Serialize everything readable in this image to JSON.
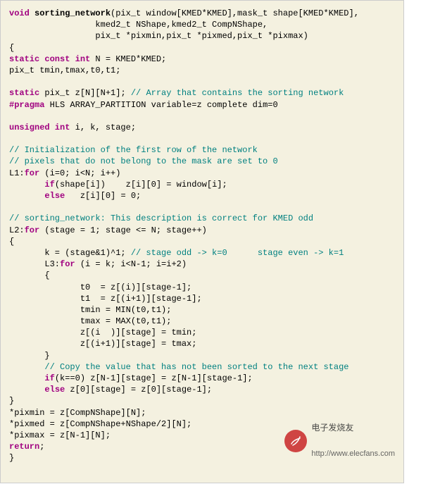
{
  "code": {
    "l1a": "void",
    "l1b": " sorting_network",
    "l1c": "(pix_t window[KMED*KMED],mask_t shape[KMED*KMED],",
    "l2": "                 kmed2_t NShape,kmed2_t CompNShape,",
    "l3": "                 pix_t *pixmin,pix_t *pixmed,pix_t *pixmax)",
    "l4": "{",
    "l5a": "static const int",
    "l5b": " N = KMED*KMED;",
    "l6": "pix_t tmin,tmax,t0,t1;",
    "l7": "",
    "l8a": "static",
    "l8b": " pix_t z[N][N+1]; ",
    "l8c": "// Array that contains the sorting network",
    "l9a": "#pragma",
    "l9b": " HLS ARRAY_PARTITION variable=z complete dim=0",
    "l10": "",
    "l11a": "unsigned int",
    "l11b": " i, k, stage;",
    "l12": "",
    "l13": "// Initialization of the first row of the network",
    "l14": "// pixels that do not belong to the mask are set to 0",
    "l15a": "L1:",
    "l15b": "for",
    "l15c": " (i=0; i<N; i++)",
    "l16a": "       ",
    "l16b": "if",
    "l16c": "(shape[i])    z[i][0] = window[i];",
    "l17a": "       ",
    "l17b": "else",
    "l17c": "   z[i][0] = 0;",
    "l18": "",
    "l19": "// sorting_network: This description is correct for KMED odd",
    "l20a": "L2:",
    "l20b": "for",
    "l20c": " (stage = 1; stage <= N; stage++)",
    "l21": "{",
    "l22a": "       k = (stage&1)^1; ",
    "l22b": "// stage odd -> k=0      stage even -> k=1",
    "l23a": "       L3:",
    "l23b": "for",
    "l23c": " (i = k; i<N-1; i=i+2)",
    "l24": "       {",
    "l25": "              t0  = z[(i)][stage-1];",
    "l26": "              t1  = z[(i+1)][stage-1];",
    "l27": "              tmin = MIN(t0,t1);",
    "l28": "              tmax = MAX(t0,t1);",
    "l29": "              z[(i  )][stage] = tmin;",
    "l30": "              z[(i+1)][stage] = tmax;",
    "l31": "       }",
    "l32": "       // Copy the value that has not been sorted to the next stage",
    "l33a": "       ",
    "l33b": "if",
    "l33c": "(k==0) z[N-1][stage] = z[N-1][stage-1];",
    "l34a": "       ",
    "l34b": "else",
    "l34c": " z[0][stage] = z[0][stage-1];",
    "l35": "}",
    "l36": "*pixmin = z[CompNShape][N];",
    "l37": "*pixmed = z[CompNShape+NShape/2][N];",
    "l38": "*pixmax = z[N-1][N];",
    "l39a": "return",
    "l39b": ";",
    "l40": "}"
  },
  "watermark": {
    "title": "电子发烧友",
    "url": "http://www.elecfans.com"
  }
}
